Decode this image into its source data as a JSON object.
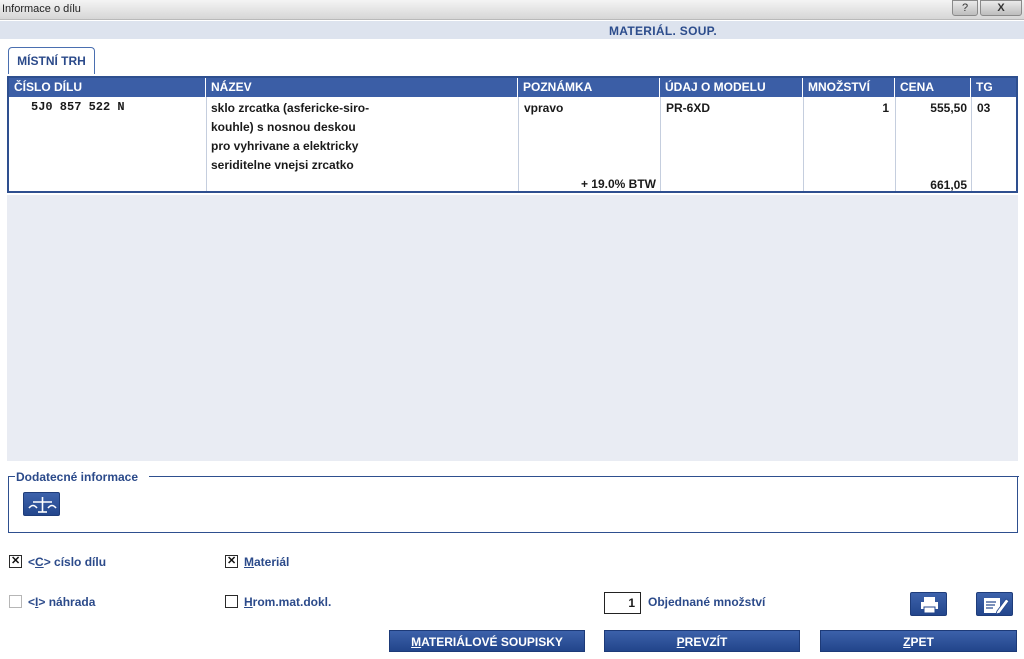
{
  "window": {
    "title": "Informace o dílu",
    "help_label": "?",
    "close_label": "X"
  },
  "subheader": {
    "text": "MATERIÁL. SOUP."
  },
  "tab": {
    "label": "MÍSTNÍ TRH"
  },
  "table": {
    "columns": [
      "ČÍSLO DÍLU",
      "NÁZEV",
      "POZNÁMKA",
      "ÚDAJ O MODELU",
      "MNOŽSTVÍ",
      "CENA",
      "TG"
    ],
    "row": {
      "part_number": "5J0 857 522 N",
      "name_lines": [
        "sklo zrcatka (asfericke-siro-",
        "kouhle) s nosnou deskou",
        "pro vyhrivane a elektricky",
        "seriditelne vnejsi zrcatko"
      ],
      "note": "vpravo",
      "model": "PR-6XD",
      "quantity": "1",
      "price": "555,50",
      "tg": "03",
      "vat_note": "+ 19.0% BTW",
      "price_with_vat": "661,05"
    }
  },
  "additional_info": {
    "label": "Dodatecné informace",
    "icon": "scales-icon"
  },
  "options": {
    "part_number_check": {
      "prefix": "<",
      "key": "C",
      "suffix": "> císlo dílu",
      "checked": true
    },
    "material_check": {
      "key": "M",
      "rest": "ateriál",
      "checked": true
    },
    "replacement_check": {
      "prefix": "<",
      "key": "I",
      "suffix": "> náhrada",
      "checked": false,
      "disabled": true
    },
    "bulk_doc_check": {
      "key": "H",
      "rest": "rom.mat.dokl.",
      "checked": false
    }
  },
  "ordered": {
    "value": "1",
    "label": "Objednané množství"
  },
  "toolbar_icons": {
    "print": "print-icon",
    "edit": "edit-notes-icon"
  },
  "buttons": {
    "material_lists": {
      "key": "M",
      "rest": "ATERIÁLOVÉ SOUPISKY"
    },
    "accept": {
      "key": "P",
      "rest": "REVZÍT"
    },
    "back": {
      "key": "Z",
      "rest": "PET"
    }
  },
  "colors": {
    "accent": "#3b5ea6",
    "header_bg": "#dde3ee",
    "empty_bg": "#e9ecf3",
    "label_blue": "#2b4a8a"
  }
}
